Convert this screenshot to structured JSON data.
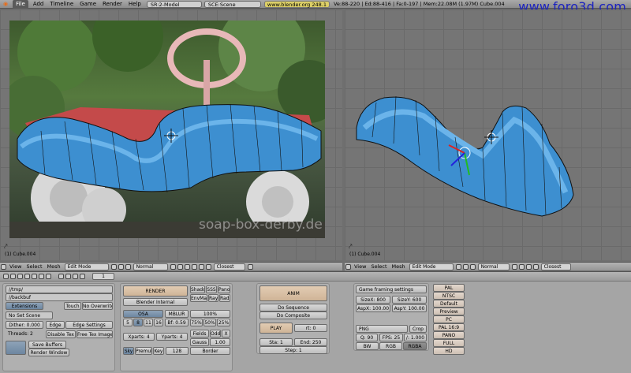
{
  "header": {
    "menus": [
      "File",
      "Add",
      "Timeline",
      "Game",
      "Render",
      "Help"
    ],
    "screen_field": "SR:2-Model",
    "scene_field": "SCE:Scene",
    "link": "www.blender.org 248.1",
    "stats": "Ve:88-220 | Ed:88-416 | Fa:0-197 | Mem:22.08M (1.97M) Cube.004"
  },
  "watermark": "www.foro3d.com",
  "left_viewport": {
    "object_label": "(1) Cube.004",
    "photo_text": "soap-box-derby.de"
  },
  "right_viewport": {
    "object_label": "(1) Cube.004"
  },
  "left_view_header": {
    "items": [
      "View",
      "Select",
      "Mesh"
    ],
    "mode": "Edit Mode",
    "pivot": "Normal",
    "snap": "Closest"
  },
  "right_view_header": {
    "items": [
      "View",
      "Select",
      "Mesh"
    ],
    "mode": "Edit Mode",
    "pivot": "Normal",
    "snap": "Closest"
  },
  "buttons_header": {
    "frame": "1"
  },
  "output": {
    "path1": "//tmp/",
    "path2": "//backbuf",
    "extensions": "Extensions",
    "touch": "Touch",
    "no_overwrite": "No Overwrite",
    "no_set_scene": "No Set Scene",
    "dither": "Dither: 0.000",
    "edge": "Edge",
    "edge_settings": "Edge Settings",
    "threads": "Threads: 2",
    "disable_tex": "Disable Tex",
    "free_tex": "Free Tex Images",
    "save_buffers": "Save Buffers",
    "render_window": "Render Window"
  },
  "render": {
    "render": "RENDER",
    "engine": "Blender Internal",
    "shadow": "Shado",
    "sss": "SSS",
    "pano": "Pano",
    "envmap": "EnvMa",
    "ray": "Ray",
    "radio": "Radi",
    "osa": "OSA",
    "mblur": "MBLUR",
    "pct100": "100%",
    "osa_vals": [
      "5",
      "8",
      "11",
      "16"
    ],
    "bf": "Bf: 0.59",
    "pct75": "75%",
    "pct50": "50%",
    "pct25": "25%",
    "xparts": "Xparts: 4",
    "yparts": "Yparts: 4",
    "fields": "Fields",
    "odd": "Odd",
    "x": "X",
    "gauss": "Gauss",
    "gauss_val": "1.00",
    "sky": "Sky",
    "premul": "Premul",
    "key": "Key",
    "bits": "128",
    "border": "Border"
  },
  "anim": {
    "anim": "ANIM",
    "do_sequence": "Do Sequence",
    "do_composite": "Do Composite",
    "play": "PLAY",
    "rt": "rt: 0",
    "sta": "Sta: 1",
    "end": "End: 250",
    "step": "Step: 1"
  },
  "format": {
    "game_framing": "Game framing settings",
    "sizex": "SizeX: 800",
    "sizey": "SizeY: 600",
    "aspx": "AspX: 100.00",
    "aspy": "AspY: 100.00",
    "file_type": "PNG",
    "crop": "Crop",
    "quality": "Q: 90",
    "fps": "FPS: 25",
    "fps_base": "/: 1.000",
    "bw": "BW",
    "rgb": "RGB",
    "rgba": "RGBA"
  },
  "presets": [
    "PAL",
    "NTSC",
    "Default",
    "Preview",
    "PC",
    "PAL 16:9",
    "PANO",
    "FULL",
    "HD"
  ],
  "colors": {
    "mesh_blue": "#3d8fd0",
    "mesh_light": "#6bb4ea",
    "watermark": "#1c23c0",
    "wire": "#111111"
  }
}
